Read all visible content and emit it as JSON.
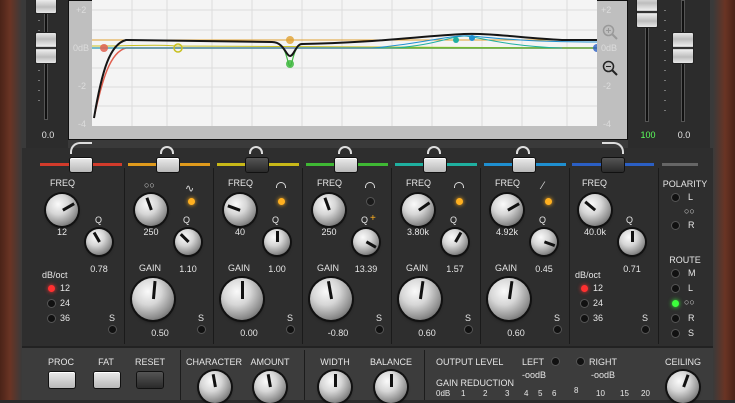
{
  "graph": {
    "left_scale": [
      "+2",
      "0dB",
      "-2",
      "-4"
    ],
    "right_scale": [
      "+2",
      "0dB",
      "-2",
      "-4"
    ],
    "zoom_in_icon": "zoom-in-icon",
    "zoom_out_icon": "zoom-out-icon"
  },
  "input_meter": {
    "value": "0.0"
  },
  "output_meters": {
    "left": "100",
    "right": "0.0"
  },
  "bands": [
    {
      "id": "hp",
      "type": "highpass",
      "freq_label": "FREQ",
      "freq": "12",
      "q_label": "Q",
      "q": "0.78",
      "slope_label": "dB/oct",
      "slopes": [
        "12",
        "24",
        "36"
      ],
      "active_slope": "12",
      "solo": "S",
      "color": "#d23b2b"
    },
    {
      "id": "b1",
      "type": "bell",
      "freq": "250",
      "q_label": "Q",
      "q": "1.10",
      "gain_label": "GAIN",
      "gain": "0.50",
      "solo": "S",
      "color": "#e09a1c"
    },
    {
      "id": "b2",
      "type": "bell",
      "freq_label": "FREQ",
      "freq": "40",
      "q_label": "Q",
      "q": "1.00",
      "gain_label": "GAIN",
      "gain": "0.00",
      "solo": "S",
      "color": "#c8b818"
    },
    {
      "id": "b3",
      "type": "bell",
      "freq_label": "FREQ",
      "freq": "250",
      "q_label": "Q",
      "q": "13.39",
      "gain_label": "GAIN",
      "gain": "-0.80",
      "solo": "S",
      "color": "#3fb834"
    },
    {
      "id": "b4",
      "type": "bell",
      "freq_label": "FREQ",
      "freq": "3.80k",
      "q_label": "Q",
      "q": "1.57",
      "gain_label": "GAIN",
      "gain": "0.60",
      "solo": "S",
      "color": "#1fb0a0"
    },
    {
      "id": "b5",
      "type": "bell",
      "freq_label": "FREQ",
      "freq": "4.92k",
      "q_label": "Q",
      "q": "0.45",
      "gain_label": "GAIN",
      "gain": "0.60",
      "solo": "S",
      "color": "#1f8fd0"
    },
    {
      "id": "lp",
      "type": "lowpass",
      "freq_label": "FREQ",
      "freq": "40.0k",
      "q_label": "Q",
      "q": "0.71",
      "slope_label": "dB/oct",
      "slopes": [
        "12",
        "24",
        "36"
      ],
      "active_slope": "12",
      "solo": "S",
      "color": "#2b5fc4"
    }
  ],
  "polarity": {
    "label": "POLARITY",
    "options": [
      "L",
      "R"
    ],
    "link_icon": "link-rings-icon"
  },
  "route": {
    "label": "ROUTE",
    "options": [
      "M",
      "L",
      "R",
      "S"
    ],
    "active": "stereo",
    "link_icon": "link-rings-icon"
  },
  "bottom": {
    "proc": "PROC",
    "fat": "FAT",
    "reset": "RESET",
    "character": "CHARACTER",
    "amount": "AMOUNT",
    "width": "WIDTH",
    "balance": "BALANCE",
    "output_level": "OUTPUT LEVEL",
    "left": "LEFT",
    "right": "RIGHT",
    "left_value": "-oodB",
    "right_value": "-oodB",
    "gain_reduction": "GAIN REDUCTION",
    "gr_scale": [
      "0dB",
      "1",
      "2",
      "3",
      "4",
      "5",
      "6",
      "8",
      "10",
      "15",
      "20"
    ],
    "ceiling": "CEILING"
  },
  "colors": {
    "background": "#3a3a3a",
    "graph_bg": "#f3f3f3",
    "wood": "#5a2a1c"
  }
}
